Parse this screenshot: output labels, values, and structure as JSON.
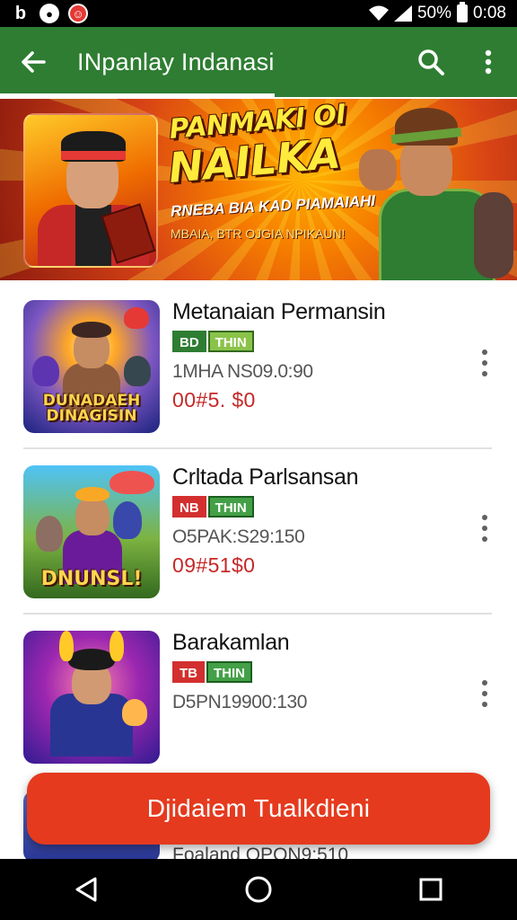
{
  "status_bar": {
    "icons": [
      "notification-b-icon",
      "game-app-icon",
      "game-app-red-icon"
    ],
    "battery_text": "50%",
    "time": "0:08"
  },
  "app_bar": {
    "title": "INpanlay Indanasi",
    "back_icon": "arrow-left-icon",
    "search_icon": "search-icon",
    "more_icon": "more-vert-icon",
    "color": "#2e7d32"
  },
  "banner": {
    "line1": "PANMAKI OI",
    "line2": "NAILKA",
    "sub1": "RNEBA BIA KAD PIAMAIAHI",
    "sub2": "MBAIA, BTR OJGIA NPIKAUN!"
  },
  "items": [
    {
      "title": "Metanaian Permansin",
      "badge1": "BD",
      "badge2": "THIN",
      "meta": "1MHA NS09.0:90",
      "price": "00#5. $0",
      "thumb_label": "DUNADAEH DINAGISIN"
    },
    {
      "title": "Crltada Parlsansan",
      "badge1": "NB",
      "badge2": "THIN",
      "meta": "O5PAK:S29:150",
      "price": "09#51$0",
      "thumb_label": "DNUNSL!"
    },
    {
      "title": "Barakamlan",
      "badge1": "TB",
      "badge2": "THIN",
      "meta": "D5PN19900:130",
      "price": "",
      "thumb_label": ""
    }
  ],
  "cta": {
    "label": "Djidaiem Tualkdieni",
    "color": "#e53a1e"
  },
  "peek_item": {
    "text": "Foaland OPON9:510"
  },
  "nav_bar": {
    "back_icon": "nav-back-icon",
    "home_icon": "nav-home-icon",
    "recents_icon": "nav-recents-icon"
  }
}
